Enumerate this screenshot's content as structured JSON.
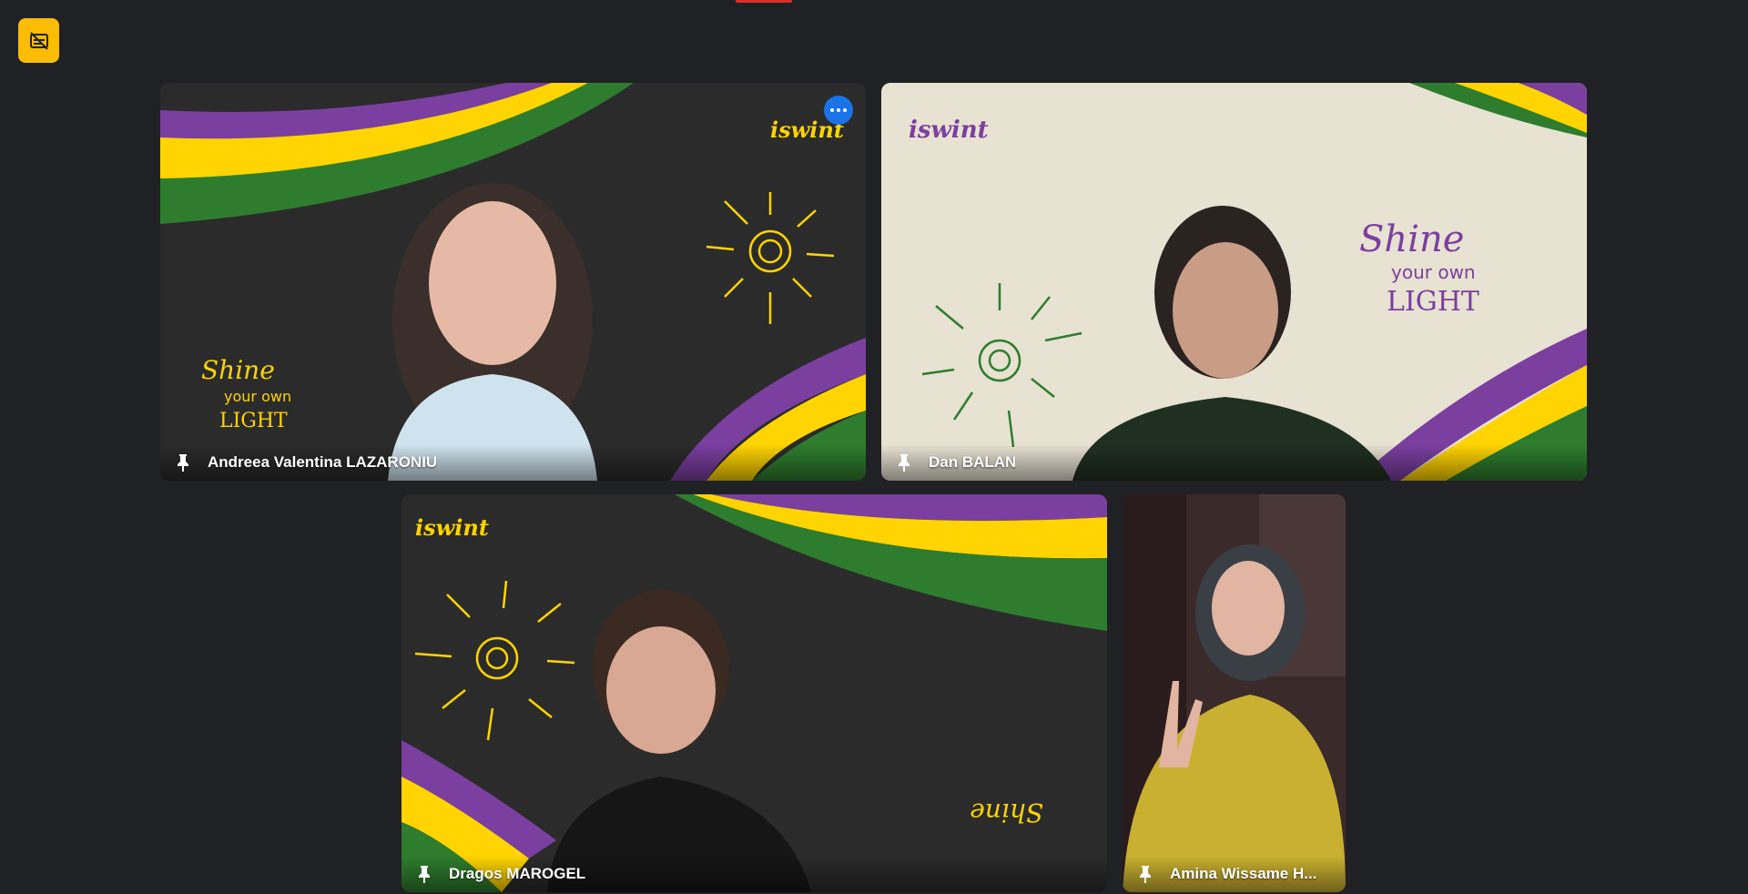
{
  "app": {
    "accent_color": "#fbbc04",
    "indicator_color": "#d93025",
    "top_button_icon": "captions-off-icon"
  },
  "participants": [
    {
      "name": "Andreea Valentina LAZARONIU",
      "pin_icon": "pin-icon",
      "has_more_button": true,
      "more_icon": "more-options-icon",
      "background": "dark-chalkboard"
    },
    {
      "name": "Dan BALAN",
      "pin_icon": "pin-icon",
      "background": "light-paper"
    },
    {
      "name": "Dragos MAROGEL",
      "pin_icon": "pin-icon",
      "background": "dark-chalkboard"
    },
    {
      "name": "Amina Wissame H...",
      "pin_icon": "pin-icon",
      "background": "room"
    }
  ],
  "backgrounds": {
    "logo_text": "iswint",
    "tagline_line1": "Shine",
    "tagline_line2": "your own",
    "tagline_line3": "LIGHT",
    "colors": {
      "purple": "#7b3fa0",
      "yellow": "#ffd400",
      "green": "#2e7d2e",
      "chalk": "#2a2a2a",
      "paper": "#e8e2d2"
    }
  }
}
